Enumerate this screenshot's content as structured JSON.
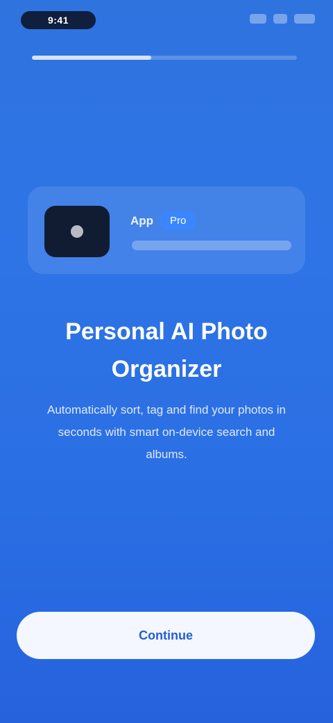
{
  "status_bar": {
    "time": "9:41",
    "icons": [
      "signal-icon",
      "wifi-icon",
      "battery-icon"
    ]
  },
  "progress": {
    "fraction": 0.45
  },
  "app_card": {
    "name": "App",
    "tag": "Pro",
    "subtitle": "",
    "icon": "app-logo-icon"
  },
  "headline": "Personal AI Photo Organizer",
  "body": "Automatically sort, tag and find your photos in seconds with smart on-device search and albums.",
  "cta": {
    "label": "Continue"
  },
  "colors": {
    "background": "#2e74e6",
    "button_bg": "#f4f7ff",
    "accent": "#3a86ff",
    "icon_bg": "#111c33"
  }
}
